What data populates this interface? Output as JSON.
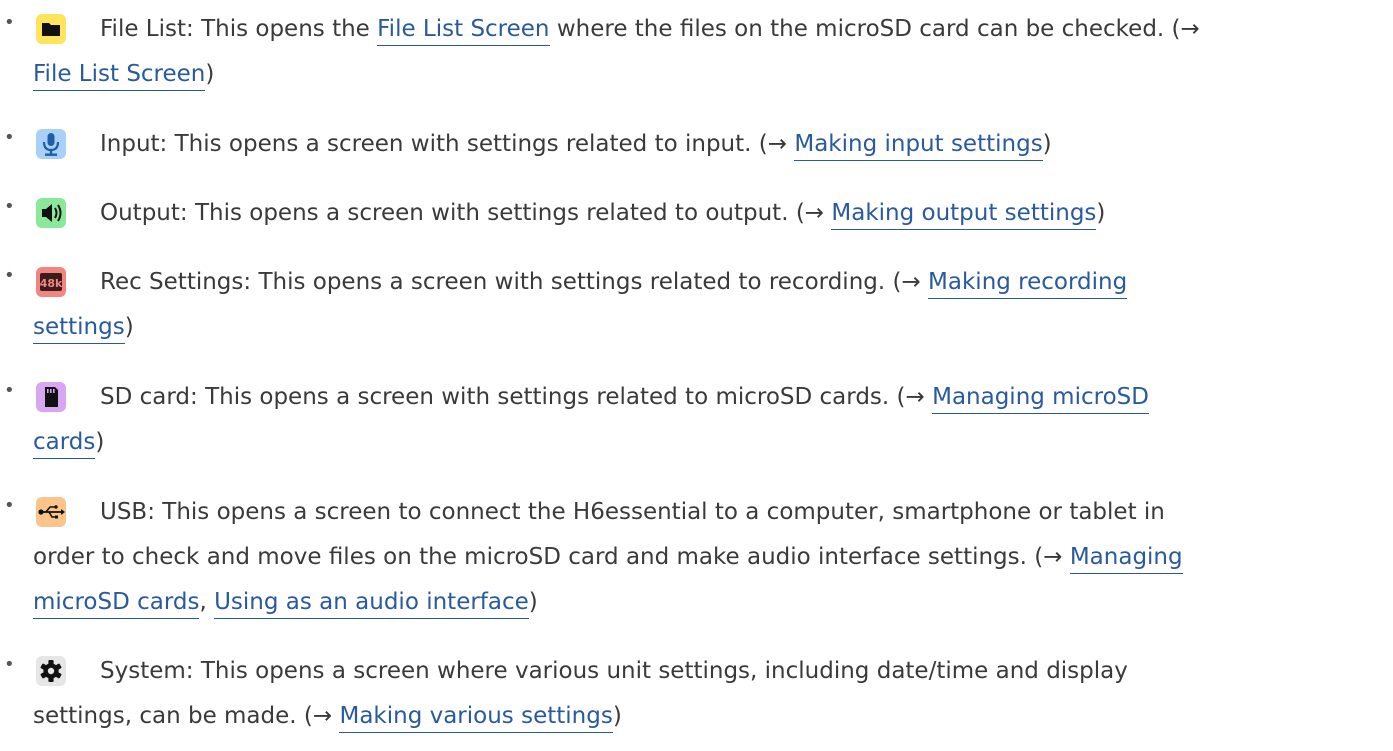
{
  "items": [
    {
      "icon": "folder-icon",
      "icon_bg": "#ffe45c",
      "line1": [
        {
          "t": "File List: This opens the "
        },
        {
          "t": "File List Screen",
          "link": true
        },
        {
          "t": " where the files on the microSD card can be checked. (→"
        }
      ],
      "line2": [
        {
          "t": "File List Screen",
          "link": true
        },
        {
          "t": ")"
        }
      ]
    },
    {
      "icon": "microphone-icon",
      "icon_bg": "#a9d1f7",
      "line1": [
        {
          "t": "Input: This opens a screen with settings related to input. (→ "
        },
        {
          "t": "Making input settings",
          "link": true
        },
        {
          "t": ")"
        }
      ]
    },
    {
      "icon": "speaker-icon",
      "icon_bg": "#8ae89a",
      "line1": [
        {
          "t": "Output: This opens a screen with settings related to output. (→ "
        },
        {
          "t": "Making output settings",
          "link": true
        },
        {
          "t": ")"
        }
      ]
    },
    {
      "icon": "rec-settings-48k-icon",
      "icon_bg": "#f2857f",
      "icon_text": "48k",
      "line1": [
        {
          "t": "Rec Settings: This opens a screen with settings related to recording. (→ "
        },
        {
          "t": "Making recording",
          "link": true
        }
      ],
      "line2": [
        {
          "t": "settings",
          "link": true
        },
        {
          "t": ")"
        }
      ]
    },
    {
      "icon": "sd-card-icon",
      "icon_bg": "#d9a6f2",
      "line1": [
        {
          "t": "SD card: This opens a screen with settings related to microSD cards. (→ "
        },
        {
          "t": "Managing microSD",
          "link": true
        }
      ],
      "line2": [
        {
          "t": "cards",
          "link": true
        },
        {
          "t": ")"
        }
      ]
    },
    {
      "icon": "usb-icon",
      "icon_bg": "#fbc48a",
      "line1": [
        {
          "t": "USB: This opens a screen to connect the H6essential to a computer, smartphone or tablet in"
        }
      ],
      "line2": [
        {
          "t": "order to check and move files on the microSD card and make audio interface settings. (→ "
        },
        {
          "t": "Managing",
          "link": true
        }
      ],
      "line3": [
        {
          "t": "microSD cards",
          "link": true
        },
        {
          "t": ", "
        },
        {
          "t": "Using as an audio interface",
          "link": true
        },
        {
          "t": ")"
        }
      ]
    },
    {
      "icon": "gear-icon",
      "icon_bg": "#e6e6e6",
      "line1": [
        {
          "t": "System: This opens a screen where various unit settings, including date/time and display"
        }
      ],
      "line2": [
        {
          "t": "settings, can be made. (→ "
        },
        {
          "t": "Making various settings",
          "link": true
        },
        {
          "t": ")"
        }
      ]
    }
  ],
  "bullet": "•"
}
